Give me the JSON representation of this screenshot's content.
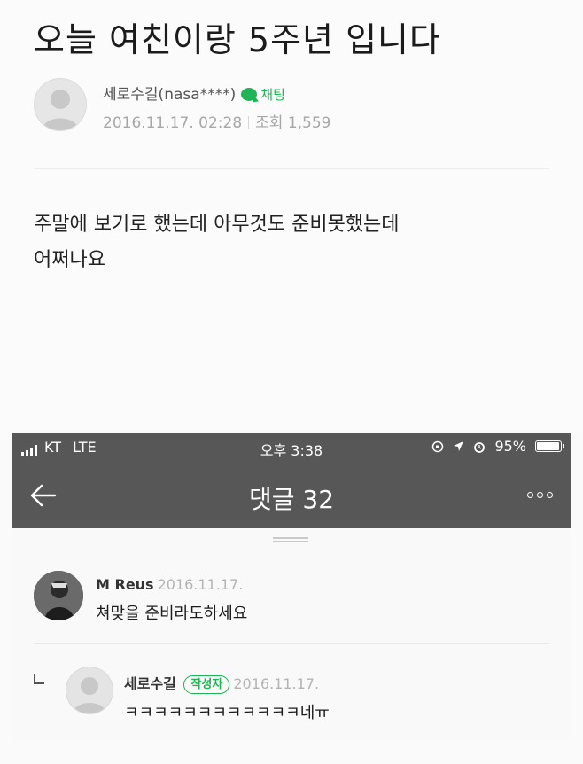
{
  "post": {
    "title": "오늘 여친이랑 5주년 입니다",
    "author": "세로수길(nasa****)",
    "chat_label": "채팅",
    "date": "2016.11.17. 02:28",
    "views": "조회 1,559",
    "body_lines": [
      "주말에 보기로 했는데 아무것도 준비못했는데",
      "어쩌나요"
    ]
  },
  "status_bar": {
    "carrier": "KT",
    "network": "LTE",
    "time": "오후 3:38",
    "battery_text": "95%",
    "battery_level": 0.95
  },
  "nav": {
    "title": "댓글 32",
    "icons": {
      "back": "back-arrow-icon",
      "more": "more-icon"
    }
  },
  "comments": [
    {
      "author": "M Reus",
      "date": "2016.11.17.",
      "text": "쳐맞을 준비라도하세요"
    },
    {
      "author": "세로수길",
      "badge": "작성자",
      "date": "2016.11.17.",
      "text": "ㅋㅋㅋㅋㅋㅋㅋㅋㅋㅋㅋㅋ네ㅠ"
    }
  ],
  "colors": {
    "accent": "#21b356",
    "header_bg": "#575757"
  }
}
